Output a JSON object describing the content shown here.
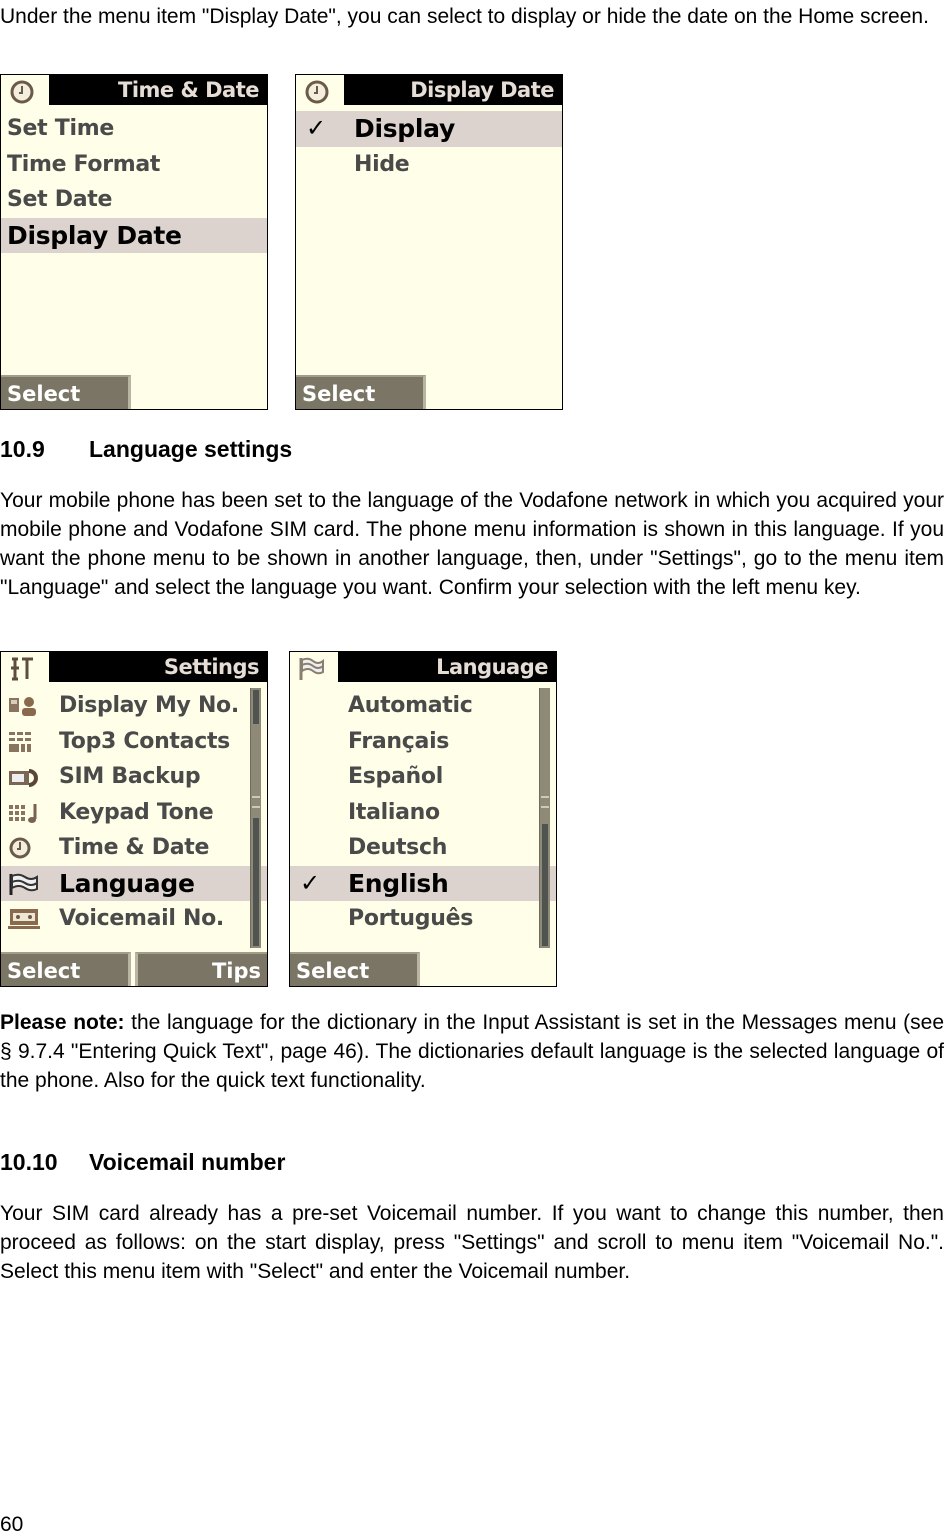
{
  "intro_paragraph": "Under the menu item \"Display Date\", you can select to display or hide the date on the Home screen.",
  "screens": {
    "time_date": {
      "title": "Time & Date",
      "header_icon": "clock-icon",
      "items": [
        {
          "label": "Set Time",
          "selected": false
        },
        {
          "label": "Time Format",
          "selected": false
        },
        {
          "label": "Set Date",
          "selected": false
        },
        {
          "label": "Display Date",
          "selected": true
        }
      ],
      "softkey_left": "Select"
    },
    "display_date": {
      "title": "Display Date",
      "header_icon": "clock-icon",
      "items": [
        {
          "label": "Display",
          "checked": true,
          "selected": true
        },
        {
          "label": "Hide",
          "checked": false,
          "selected": false
        }
      ],
      "softkey_left": "Select",
      "check_glyph": "✓"
    },
    "settings": {
      "title": "Settings",
      "header_icon": "tools-icon",
      "items": [
        {
          "label": "Display My No.",
          "icon": "phone-person-icon",
          "selected": false
        },
        {
          "label": "Top3 Contacts",
          "icon": "contacts-grid-icon",
          "selected": false
        },
        {
          "label": "SIM Backup",
          "icon": "sim-backup-icon",
          "selected": false
        },
        {
          "label": "Keypad Tone",
          "icon": "keypad-note-icon",
          "selected": false
        },
        {
          "label": "Time & Date",
          "icon": "clock-icon",
          "selected": false
        },
        {
          "label": "Language",
          "icon": "flag-icon",
          "selected": true
        },
        {
          "label": "Voicemail No.",
          "icon": "voicemail-tape-icon",
          "selected": false
        }
      ],
      "softkey_left": "Select",
      "softkey_right": "Tips"
    },
    "language": {
      "title": "Language",
      "header_icon": "flag-icon",
      "items": [
        {
          "label": "Automatic",
          "checked": false,
          "selected": false
        },
        {
          "label": "Français",
          "checked": false,
          "selected": false
        },
        {
          "label": "Español",
          "checked": false,
          "selected": false
        },
        {
          "label": "Italiano",
          "checked": false,
          "selected": false
        },
        {
          "label": "Deutsch",
          "checked": false,
          "selected": false
        },
        {
          "label": "English",
          "checked": true,
          "selected": true
        },
        {
          "label": "Português",
          "checked": false,
          "selected": false
        }
      ],
      "softkey_left": "Select",
      "check_glyph": "✓"
    }
  },
  "section_language": {
    "number": "10.9",
    "title": "Language settings",
    "paragraph": "Your mobile phone has been set to the language of the Vodafone network in which you acquired your mobile phone and Vodafone SIM card. The phone menu information is shown in this language. If you want the phone menu to be shown in another language, then, under \"Settings\", go to the menu item \"Language\" and select the language you want. Confirm your selection with the left menu key."
  },
  "note": {
    "label": "Please note:",
    "text": " the language for the dictionary in the Input Assistant is set in the Messages menu (see § 9.7.4 \"Entering Quick Text\", page 46). The dictionaries default language is the selected language of the phone. Also for the quick text functionality."
  },
  "section_voicemail": {
    "number": "10.10",
    "title": "Voicemail number",
    "paragraph": "Your SIM card already has a pre-set Voicemail number. If you want to change this number, then proceed as follows: on the start display, press \"Settings\" and scroll to menu item \"Voicemail No.\". Select this menu item with \"Select\" and enter the Voicemail number."
  },
  "page_number": "60",
  "colors": {
    "screen_bg": "#fffee8",
    "selection_bg": "#dcd3cf",
    "softkey_bg": "#7a7565",
    "header_bg": "#000000"
  }
}
